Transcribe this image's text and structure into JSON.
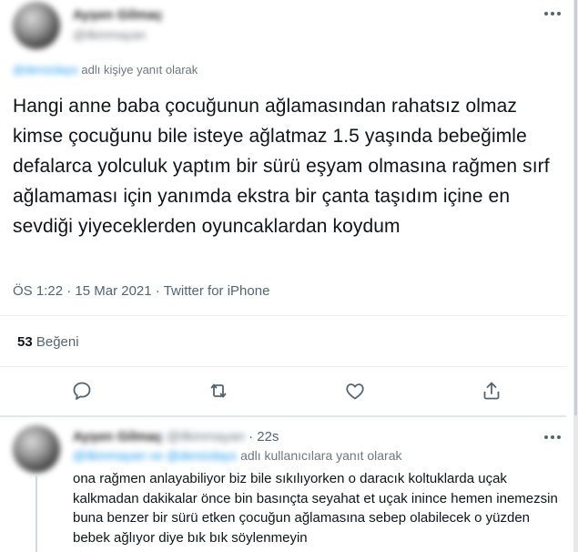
{
  "main_tweet": {
    "author_name": "Ayşen Gilmaç",
    "author_handle": "@ilkinmayan",
    "more_icon": "more-horizontal-icon",
    "reply_mention": "@denizdays",
    "reply_context": "adlı kişiye yanıt olarak",
    "text": "Hangi anne baba çocuğunun ağlamasından rahatsız olmaz kimse çocuğunu bile isteye ağlatmaz 1.5 yaşında bebeğimle defalarca yolculuk yaptım bir sürü eşyam olmasına rağmen sırf ağlamaması için yanımda ekstra bir çanta taşıdım içine en sevdiği yiyeceklerden oyuncaklardan koydum",
    "time": "ÖS 1:22",
    "separator": "·",
    "date": "15 Mar 2021",
    "source": "Twitter for iPhone",
    "likes_count": "53",
    "likes_label": "Beğeni",
    "actions": [
      {
        "name": "reply-icon"
      },
      {
        "name": "retweet-icon"
      },
      {
        "name": "like-icon"
      },
      {
        "name": "share-icon"
      }
    ]
  },
  "reply_tweet": {
    "author_name": "Ayşen Gilmaç",
    "author_handle": "@ilkinmayan",
    "separator": "·",
    "time": "22s",
    "mentions": "@ilkinmayan ve @denizdays",
    "reply_context": "adlı kullanıcılara yanıt olarak",
    "text": "ona rağmen anlayabiliyor biz bile sıkılıyorken o daracık koltuklarda uçak kalkmadan dakikalar önce bin basınçta seyahat et uçak inince hemen inemezsin buna benzer bir sürü etken çocuğun ağlamasına sebep olabilecek o yüzden bebek ağlıyor diye bık bık söylenmeyin"
  },
  "colors": {
    "text": "#0f1419",
    "secondary": "#536471",
    "link": "#1d9bf0",
    "divider": "#e6ecf0"
  }
}
